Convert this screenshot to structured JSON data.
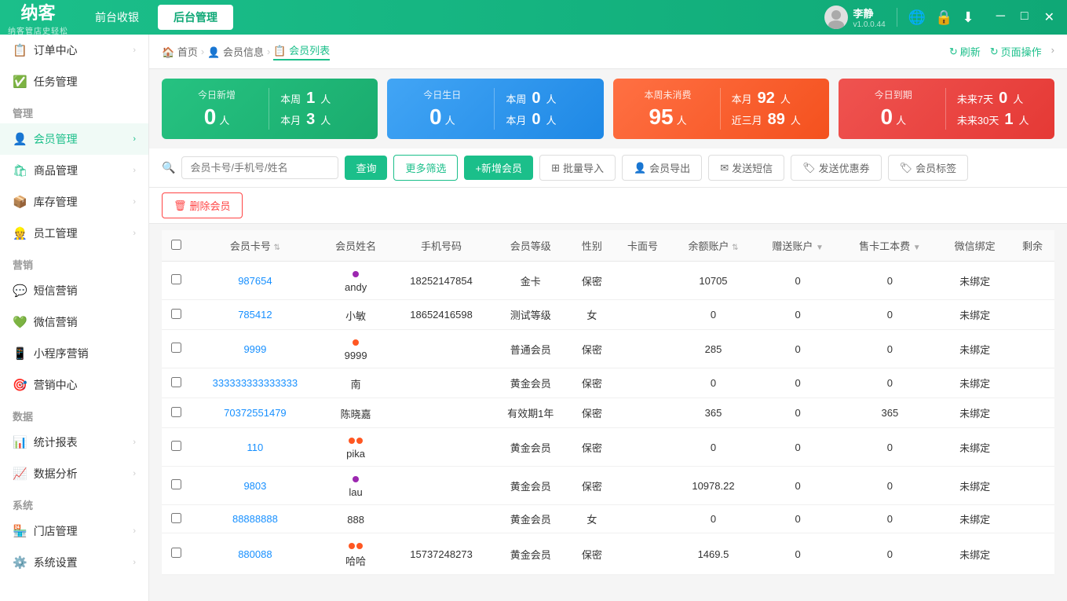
{
  "topbar": {
    "logo": "纳客",
    "logo_sub": "纳客管店史轻松",
    "tab_frontend": "前台收银",
    "tab_backend": "后台管理",
    "user_name": "李静",
    "version": "v1.0.0.44"
  },
  "breadcrumb": {
    "home": "首页",
    "member_info": "会员信息",
    "member_list": "会员列表",
    "refresh": "刷新",
    "page_actions": "页面操作"
  },
  "stats": {
    "new_today_label": "今日新增",
    "new_today_value": "0",
    "new_today_unit": "人",
    "new_week_label": "本周",
    "new_week_value": "1",
    "new_week_unit": "人",
    "new_month_label": "本月",
    "new_month_value": "3",
    "new_month_unit": "人",
    "birthday_today_label": "今日生日",
    "birthday_today_value": "0",
    "birthday_today_unit": "人",
    "birthday_week_label": "本周",
    "birthday_week_value": "0",
    "birthday_week_unit": "人",
    "birthday_month_label": "本月",
    "birthday_month_value": "0",
    "birthday_month_unit": "人",
    "no_consume_week_label": "本周未消费",
    "no_consume_week_value": "95",
    "no_consume_week_unit": "人",
    "no_consume_month_label": "本月",
    "no_consume_month_value": "92",
    "no_consume_month_unit": "人",
    "no_consume_3month_label": "近三月",
    "no_consume_3month_value": "89",
    "no_consume_3month_unit": "人",
    "expire_today_label": "今日到期",
    "expire_today_value": "0",
    "expire_today_unit": "人",
    "expire_7days_label": "未来7天",
    "expire_7days_value": "0",
    "expire_7days_unit": "人",
    "expire_30days_label": "未来30天",
    "expire_30days_value": "1",
    "expire_30days_unit": "人"
  },
  "toolbar": {
    "search_placeholder": "会员卡号/手机号/姓名",
    "search_btn": "查询",
    "filter_btn": "更多筛选",
    "add_btn": "+新增会员",
    "batch_import_btn": "批量导入",
    "export_btn": "会员导出",
    "sms_btn": "发送短信",
    "coupon_btn": "发送优惠券",
    "tag_btn": "会员标签",
    "delete_btn": "删除会员"
  },
  "table": {
    "headers": [
      "会员卡号",
      "会员姓名",
      "手机号码",
      "会员等级",
      "性别",
      "卡面号",
      "余额账户",
      "赠送账户",
      "售卡工本费",
      "微信绑定",
      "剩余"
    ],
    "rows": [
      {
        "card_no": "987654",
        "name": "andy",
        "dot": "purple",
        "phone": "18252147854",
        "level": "金卡",
        "gender": "保密",
        "face_no": "",
        "balance": "10705",
        "gift": "0",
        "cost": "0",
        "wechat": "未绑定"
      },
      {
        "card_no": "785412",
        "name": "小敏",
        "dot": "",
        "phone": "18652416598",
        "level": "测试等级",
        "gender": "女",
        "face_no": "",
        "balance": "0",
        "gift": "0",
        "cost": "0",
        "wechat": "未绑定"
      },
      {
        "card_no": "9999",
        "name": "9999",
        "dot": "orange",
        "phone": "",
        "level": "普通会员",
        "gender": "保密",
        "face_no": "",
        "balance": "285",
        "gift": "0",
        "cost": "0",
        "wechat": "未绑定"
      },
      {
        "card_no": "333333333333333",
        "name": "南",
        "dot": "",
        "phone": "",
        "level": "黄金会员",
        "gender": "保密",
        "face_no": "",
        "balance": "0",
        "gift": "0",
        "cost": "0",
        "wechat": "未绑定"
      },
      {
        "card_no": "70372551479",
        "name": "陈晓嘉",
        "dot": "",
        "phone": "",
        "level": "有效期1年",
        "gender": "保密",
        "face_no": "",
        "balance": "365",
        "gift": "0",
        "cost": "365",
        "wechat": "未绑定"
      },
      {
        "card_no": "110",
        "name": "pika",
        "dot": "orange_orange",
        "phone": "",
        "level": "黄金会员",
        "gender": "保密",
        "face_no": "",
        "balance": "0",
        "gift": "0",
        "cost": "0",
        "wechat": "未绑定"
      },
      {
        "card_no": "9803",
        "name": "lau",
        "dot": "purple",
        "phone": "",
        "level": "黄金会员",
        "gender": "保密",
        "face_no": "",
        "balance": "10978.22",
        "gift": "0",
        "cost": "0",
        "wechat": "未绑定"
      },
      {
        "card_no": "88888888",
        "name": "888",
        "dot": "",
        "phone": "",
        "level": "黄金会员",
        "gender": "女",
        "face_no": "",
        "balance": "0",
        "gift": "0",
        "cost": "0",
        "wechat": "未绑定"
      },
      {
        "card_no": "880088",
        "name": "哈哈",
        "dot": "orange_orange",
        "phone": "15737248273",
        "level": "黄金会员",
        "gender": "保密",
        "face_no": "",
        "balance": "1469.5",
        "gift": "0",
        "cost": "0",
        "wechat": "未绑定"
      }
    ]
  },
  "sidebar": {
    "sections": [
      {
        "title": "",
        "items": [
          {
            "icon": "📋",
            "label": "订单中心",
            "has_arrow": true
          },
          {
            "icon": "✅",
            "label": "任务管理",
            "has_arrow": false
          }
        ]
      },
      {
        "title": "管理",
        "items": [
          {
            "icon": "👤",
            "label": "会员管理",
            "has_arrow": true,
            "active": true
          },
          {
            "icon": "🛍",
            "label": "商品管理",
            "has_arrow": true
          },
          {
            "icon": "📦",
            "label": "库存管理",
            "has_arrow": true
          },
          {
            "icon": "👷",
            "label": "员工管理",
            "has_arrow": true
          }
        ]
      },
      {
        "title": "营销",
        "items": [
          {
            "icon": "💬",
            "label": "短信营销",
            "has_arrow": false
          },
          {
            "icon": "💚",
            "label": "微信营销",
            "has_arrow": false
          },
          {
            "icon": "📱",
            "label": "小程序营销",
            "has_arrow": false
          },
          {
            "icon": "🎯",
            "label": "营销中心",
            "has_arrow": false
          }
        ]
      },
      {
        "title": "数据",
        "items": [
          {
            "icon": "📊",
            "label": "统计报表",
            "has_arrow": true
          },
          {
            "icon": "📈",
            "label": "数据分析",
            "has_arrow": true
          }
        ]
      },
      {
        "title": "系统",
        "items": [
          {
            "icon": "🏪",
            "label": "门店管理",
            "has_arrow": true
          },
          {
            "icon": "⚙️",
            "label": "系统设置",
            "has_arrow": true
          }
        ]
      }
    ]
  }
}
